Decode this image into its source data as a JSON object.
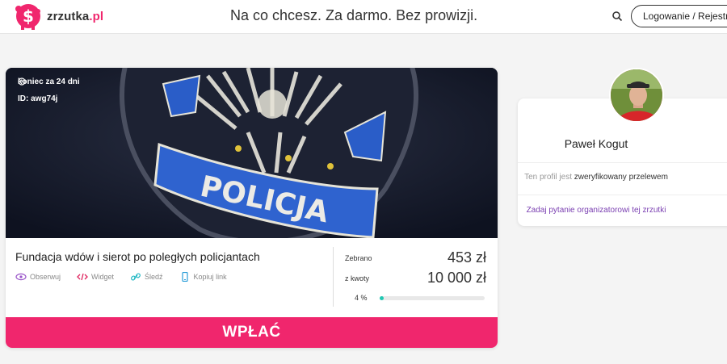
{
  "header": {
    "logo_name": "zrzutka",
    "logo_tld": ".pl",
    "tagline": "Na co chcesz. Za darmo. Bez prowizji.",
    "login_label": "Logowanie / Rejestracja",
    "brand_color": "#f0266d"
  },
  "campaign": {
    "hero_badge_text": "POLICJA",
    "end_label": "koniec za 24 dni",
    "id_label": "ID: awg74j",
    "title": "Fundacja wdów i sierot po poległych policjantach",
    "actions": [
      "Obserwuj",
      "Widget",
      "Śledź",
      "Kopiuj link"
    ],
    "raised_label": "Zebrano",
    "raised_value": "453 zł",
    "goal_label": "z kwoty",
    "goal_value": "10 000 zł",
    "percent_label": "4 %",
    "progress_fraction": 0.04,
    "pay_label": "WPŁAĆ"
  },
  "organizer": {
    "name": "Paweł Kogut",
    "verified_prefix": "Ten profil jest",
    "verified_strong": "zweryfikowany przelewem",
    "ask_label": "Zadaj pytanie organizatorowi tej zrzutki"
  }
}
